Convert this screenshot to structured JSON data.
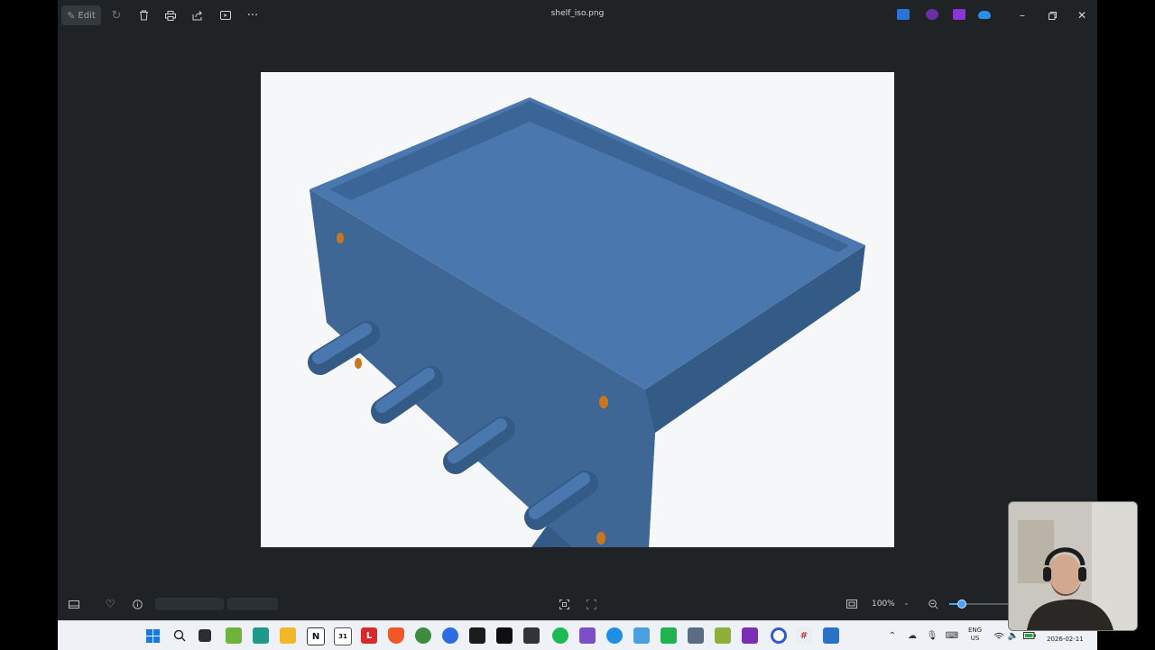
{
  "toolbar": {
    "edit_label": "Edit",
    "icons": [
      "edit-pen-icon",
      "rotate-icon",
      "delete-icon",
      "print-icon",
      "share-icon",
      "slideshow-icon",
      "more-icon"
    ]
  },
  "window": {
    "title": "shelf_iso.png",
    "controls": [
      "minimize-icon",
      "restore-icon",
      "close-icon"
    ]
  },
  "image_view": {
    "subject": "3D isometric render of blue shelf with four pegs and orange holes",
    "colors": {
      "background": "#f6f7f8",
      "top": "#4a78ae",
      "front": "#3e6796",
      "side": "#345a86",
      "rim_inner": "#3a6596",
      "hole": "#c9771e"
    }
  },
  "bottombar": {
    "zoom_level": "100%",
    "zoom_fraction": 0.12
  },
  "taskbar": {
    "tray_language": [
      "ENG",
      "US"
    ],
    "date": "2026-02-11"
  }
}
